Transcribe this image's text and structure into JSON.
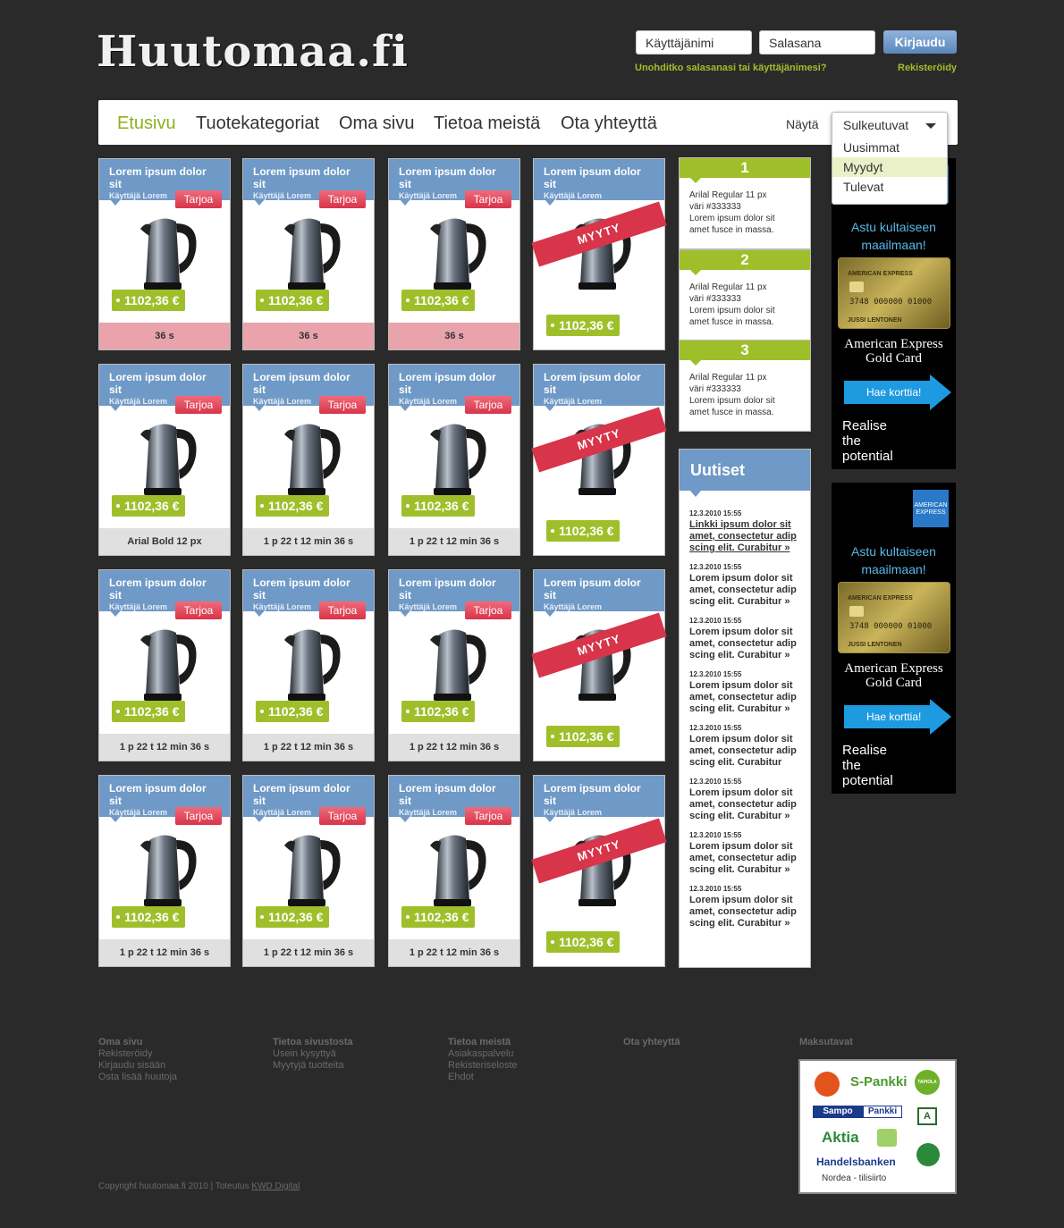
{
  "header": {
    "logo": "Huutomaa.fi",
    "username_placeholder": "Käyttäjänimi",
    "password_placeholder": "Salasana",
    "login_label": "Kirjaudu",
    "forgot_link": "Unohditko salasanasi tai käyttäjänimesi?",
    "register_link": "Rekisteröidy"
  },
  "nav": {
    "items": [
      "Etusivu",
      "Tuotekategoriat",
      "Oma sivu",
      "Tietoa meistä",
      "Ota yhteyttä"
    ],
    "active": "Etusivu",
    "show_label": "Näytä",
    "dropdown": {
      "selected": "Sulkeutuvat",
      "options": [
        "Uusimmat",
        "Myydyt",
        "Tulevat"
      ],
      "highlighted": "Myydyt"
    }
  },
  "cards": {
    "title": "Lorem ipsum dolor sit",
    "user": "Käyttäjä Lorem",
    "bid_label": "Tarjoa",
    "price": "1102,36 €",
    "sold_label": "MYYTY",
    "rows": [
      [
        "36 s",
        "36 s",
        "36 s"
      ],
      [
        "Arial Bold 12 px",
        "1 p 22 t 12 min 36 s",
        "1 p 22 t 12 min 36 s"
      ],
      [
        "1 p 22 t 12 min 36 s",
        "1 p 22 t 12 min 36 s",
        "1 p 22 t 12 min 36 s"
      ],
      [
        "1 p 22 t 12 min 36 s",
        "1 p 22 t 12 min 36 s",
        "1 p 22 t 12 min 36 s"
      ]
    ]
  },
  "steps": [
    {
      "num": "1",
      "lines": [
        "Arilal Regular 11 px",
        "väri #333333",
        "Lorem ipsum dolor sit",
        "amet fusce in massa."
      ]
    },
    {
      "num": "2",
      "lines": [
        "Arilal Regular 11 px",
        "väri #333333",
        "Lorem ipsum dolor sit",
        "amet fusce in massa."
      ]
    },
    {
      "num": "3",
      "lines": [
        "Arilal Regular 11 px",
        "väri #333333",
        "Lorem ipsum dolor sit",
        "amet fusce in massa."
      ]
    }
  ],
  "news": {
    "title": "Uutiset",
    "items": [
      {
        "date": "12.3.2010 15:55",
        "text": "Linkki ipsum dolor sit amet, consectetur adip scing elit. Curabitur »",
        "link": true
      },
      {
        "date": "12.3.2010 15:55",
        "text": "Lorem ipsum dolor sit amet, consectetur adip scing elit. Curabitur »",
        "link": false
      },
      {
        "date": "12.3.2010 15:55",
        "text": "Lorem ipsum dolor sit amet, consectetur adip scing elit. Curabitur »",
        "link": false
      },
      {
        "date": "12.3.2010 15:55",
        "text": "Lorem ipsum dolor sit amet, consectetur adip scing elit. Curabitur »",
        "link": false
      },
      {
        "date": "12.3.2010 15:55",
        "text": "Lorem ipsum dolor sit amet, consectetur adip scing elit. Curabitur",
        "link": false
      },
      {
        "date": "12.3.2010 15:55",
        "text": "Lorem ipsum dolor sit amet, consectetur adip scing elit. Curabitur »",
        "link": false
      },
      {
        "date": "12.3.2010 15:55",
        "text": "Lorem ipsum dolor sit amet, consectetur adip scing elit. Curabitur »",
        "link": false
      },
      {
        "date": "12.3.2010 15:55",
        "text": "Lorem ipsum dolor sit amet, consectetur adip scing elit. Curabitur »",
        "link": false
      }
    ]
  },
  "ads": [
    {
      "logo": "AMERICAN EXPRESS",
      "headline": "Astu kultaiseen maailmaan!",
      "card_brand": "AMERICAN EXPRESS",
      "card_number": "3748 000000 01000",
      "card_name": "JUSSI LENTONEN",
      "product": "American Express Gold Card",
      "cta": "Hae korttia!",
      "slogan": "Realise the potential"
    },
    {
      "logo": "AMERICAN EXPRESS",
      "headline": "Astu kultaiseen maailmaan!",
      "card_brand": "AMERICAN EXPRESS",
      "card_number": "3748 000000 01000",
      "card_name": "JUSSI LENTONEN",
      "product": "American Express Gold Card",
      "cta": "Hae korttia!",
      "slogan": "Realise the potential"
    }
  ],
  "footer": {
    "columns": [
      {
        "title": "Oma sivu",
        "links": [
          "Rekisteröidy",
          "Kirjaudu sisään",
          "Osta lisää huutoja"
        ]
      },
      {
        "title": "Tietoa sivustosta",
        "links": [
          "Usein kysyttyä",
          "Myytyjä tuotteita"
        ]
      },
      {
        "title": "Tietoa meistä",
        "links": [
          "Asiakaspalvelu",
          "Rekisteriseloste",
          "Ehdot"
        ]
      },
      {
        "title": "Ota yhteyttä",
        "links": []
      }
    ],
    "payments_title": "Maksutavat",
    "banks": [
      "S-Pankki",
      "TAPIOLA",
      "Sampo",
      "Pankki",
      "Aktia",
      "Handelsbanken",
      "Nordea - tilisiirto"
    ],
    "copyright": "Copyright huutomaa.fi 2010 | Toteutus",
    "credit_link": "KWD Digital"
  }
}
